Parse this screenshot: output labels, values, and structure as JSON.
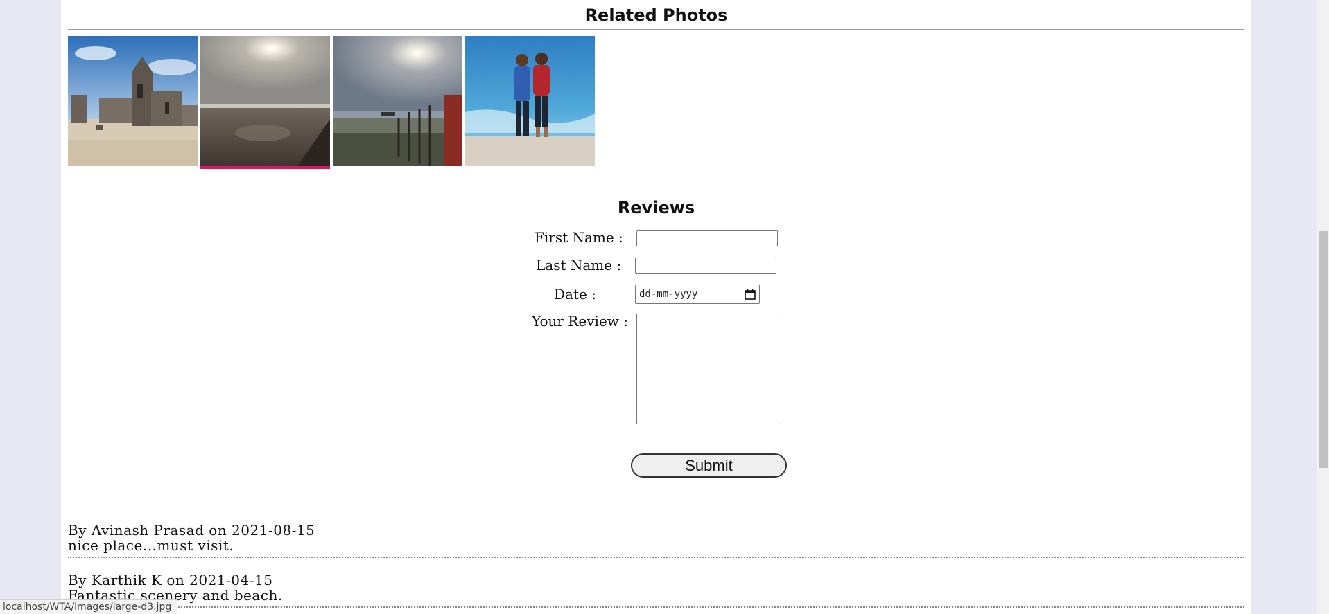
{
  "related": {
    "title": "Related Photos",
    "photos": [
      {
        "icon": "church-ruins-photo",
        "active": false
      },
      {
        "icon": "sunset-beach-photo",
        "active": true
      },
      {
        "icon": "sun-shore-photo",
        "active": false
      },
      {
        "icon": "two-friends-beach-photo",
        "active": false
      }
    ]
  },
  "reviews": {
    "title": "Reviews",
    "form": {
      "first_name_label": "First Name :",
      "last_name_label": "Last Name :",
      "date_label": "Date :",
      "date_placeholder": "dd-mm-yyyy",
      "review_label": "Your Review :",
      "first_name_value": "",
      "last_name_value": "",
      "review_value": "",
      "submit_label": "Submit"
    },
    "items": [
      {
        "byline": "By Avinash Prasad on 2021-08-15",
        "text": "nice place...must visit."
      },
      {
        "byline": "By Karthik K on 2021-04-15",
        "text": "Fantastic scenery and beach."
      }
    ]
  },
  "status_bar": {
    "url": "localhost/WTA/images/large-d3.jpg"
  },
  "colors": {
    "page_background": "#e7e8f4",
    "active_thumb_accent": "#e0145f"
  }
}
